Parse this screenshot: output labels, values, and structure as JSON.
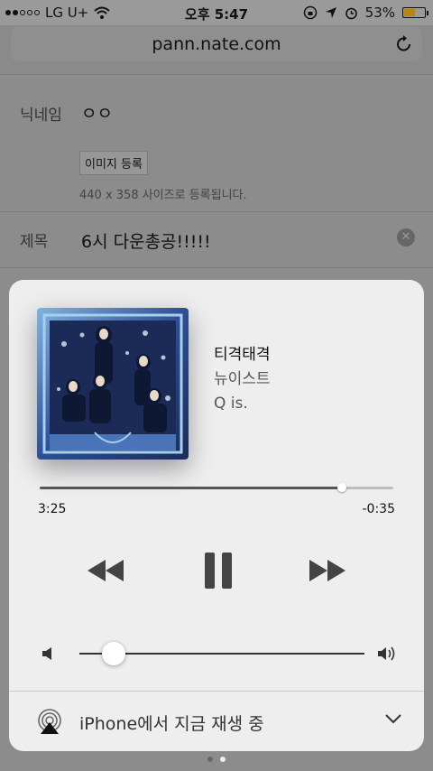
{
  "status_bar": {
    "carrier": "LG U+",
    "time": "오후 5:47",
    "battery_percent": "53%",
    "battery_level": 0.53,
    "battery_color": "#b8860b"
  },
  "browser": {
    "url": "pann.nate.com"
  },
  "form": {
    "nickname_label": "닉네임",
    "nickname_value": "ㅇㅇ",
    "image_button": "이미지 등록",
    "image_hint": "440 x 358 사이즈로 등록됩니다.",
    "title_label": "제목",
    "title_value": "6시 다운총공!!!!!"
  },
  "now_playing": {
    "song": "티격태격",
    "artist": "뉴이스트",
    "album": "Q is.",
    "elapsed": "3:25",
    "remaining": "-0:35",
    "progress": 0.854,
    "volume": 0.12
  },
  "airplay": {
    "label": "iPhone에서 지금 재생 중"
  },
  "page_indicator": {
    "count": 2,
    "active": 1
  }
}
